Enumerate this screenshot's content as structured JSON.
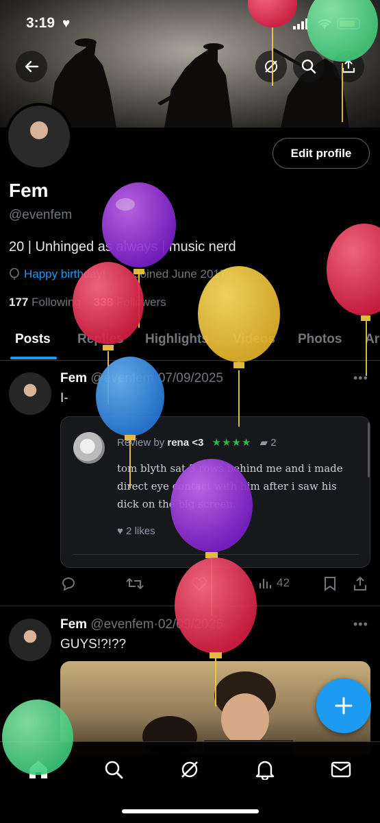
{
  "status_bar": {
    "time": "3:19",
    "heart": "♥"
  },
  "profile": {
    "name": "Fem",
    "handle": "@evenfem",
    "bio": "20 | Unhinged as always | music nerd",
    "birthday": "Happy birthday!",
    "joined": "Joined June 2017",
    "following_count": "177",
    "following_label": "Following",
    "followers_count": "338",
    "followers_label": "Followers",
    "edit_label": "Edit profile"
  },
  "tabs": [
    "Posts",
    "Replies",
    "Highlights",
    "Videos",
    "Photos",
    "Ar"
  ],
  "posts": [
    {
      "name": "Fem",
      "handle": "@evenfem",
      "date": "07/09/2025",
      "text": "I-",
      "quote": {
        "review_prefix": "Review by",
        "reviewer": "rena <3",
        "stars": "★★★★",
        "comments": "2",
        "body": "tom blyth sat 3 rows behind me and i made direct eye contact with him after i saw his dick on the big screen",
        "likes": "2 likes"
      },
      "views": "42"
    },
    {
      "name": "Fem",
      "handle": "@evenfem",
      "date": "02/09/2025",
      "text": "GUYS!?!??"
    }
  ],
  "icons": {
    "back": "back-arrow-icon",
    "grok": "grok-icon",
    "search": "search-icon",
    "share": "share-icon",
    "more": "more-icon",
    "compose": "plus-icon"
  },
  "colors": {
    "accent": "#1d9bf0",
    "background": "#000000",
    "muted": "#71767b"
  }
}
